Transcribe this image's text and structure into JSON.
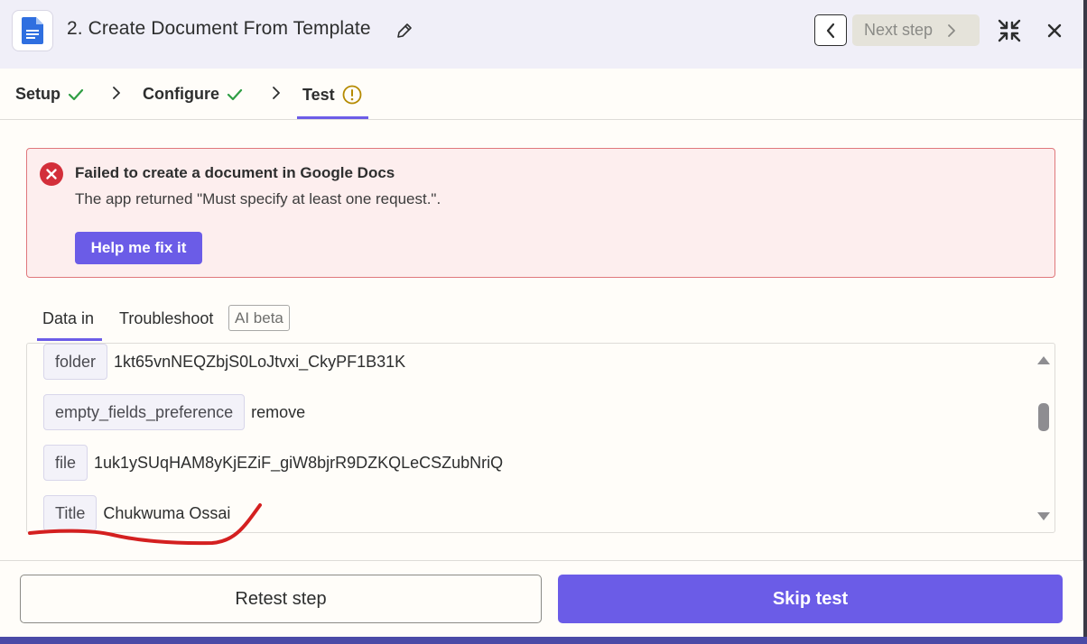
{
  "header": {
    "title": "2. Create Document From Template",
    "next_step_label": "Next step"
  },
  "steps": [
    {
      "label": "Setup",
      "status": "complete"
    },
    {
      "label": "Configure",
      "status": "complete"
    },
    {
      "label": "Test",
      "status": "warning"
    }
  ],
  "error": {
    "title": "Failed to create a document in Google Docs",
    "message": "The app returned \"Must specify at least one request.\".",
    "help_button": "Help me fix it"
  },
  "data_tabs": {
    "data_in": "Data in",
    "troubleshoot": "Troubleshoot",
    "ai_badge": "AI beta"
  },
  "fields": [
    {
      "key": "folder",
      "value": "1kt65vnNEQZbjS0LoJtvxi_CkyPF1B31K"
    },
    {
      "key": "empty_fields_preference",
      "value": "remove"
    },
    {
      "key": "file",
      "value": "1uk1ySUqHAM8yKjEZiF_giW8bjrR9DZKQLeCSZubNriQ"
    },
    {
      "key": "Title",
      "value": "Chukwuma Ossai"
    }
  ],
  "footer": {
    "retest_label": "Retest step",
    "skip_label": "Skip test"
  },
  "colors": {
    "accent": "#6b5ce7",
    "success": "#2f9e44",
    "warning": "#b58a00",
    "error": "#d32f3a",
    "annotation": "#d42020"
  }
}
